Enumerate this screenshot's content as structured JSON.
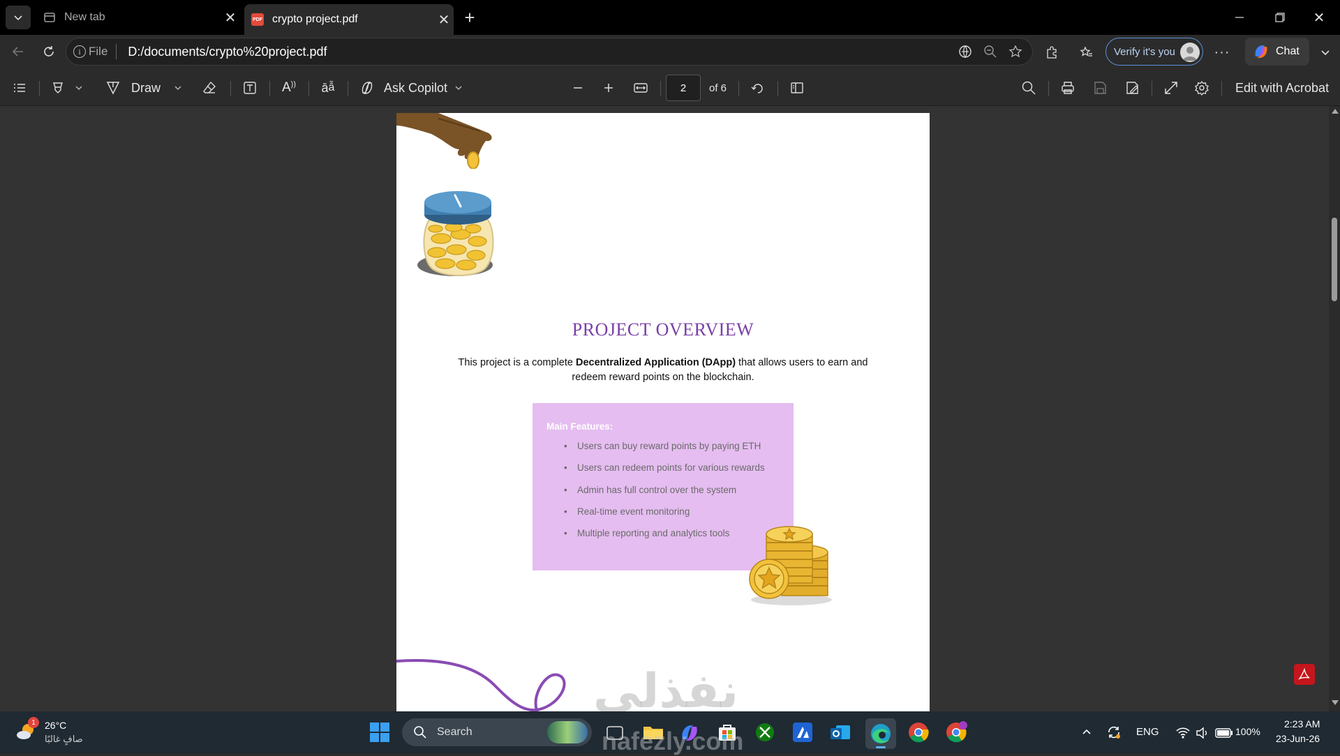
{
  "tabs": [
    {
      "label": "New tab",
      "icon": "new-tab-page-icon",
      "active": false
    },
    {
      "label": "crypto project.pdf",
      "icon": "pdf-file-icon",
      "active": true
    }
  ],
  "address": {
    "scheme_label": "File",
    "url": "D:/documents/crypto%20project.pdf"
  },
  "profile": {
    "verify_label": "Verify it's you"
  },
  "copilot_chat_label": "Chat",
  "pdf_toolbar": {
    "draw_label": "Draw",
    "ask_copilot_label": "Ask Copilot",
    "page_current": "2",
    "page_total_label": "of 6",
    "edit_acrobat_label": "Edit with Acrobat"
  },
  "document": {
    "heading": "PROJECT OVERVIEW",
    "intro_prefix": "This project is a complete ",
    "intro_bold": "Decentralized Application (DApp)",
    "intro_suffix": " that allows users to earn and redeem reward points on the blockchain.",
    "features_heading": "Main Features:",
    "features": [
      "Users can buy reward points by paying ETH",
      "Users can redeem points for various rewards",
      "Admin has full control over the system",
      "Real-time event monitoring",
      "Multiple reporting and analytics tools"
    ]
  },
  "watermark": {
    "arabic": "نفذلي",
    "latin": "nafezly.com"
  },
  "taskbar": {
    "weather_temp": "26°C",
    "weather_desc": "صافٍ غالبًا",
    "weather_badge": "1",
    "search_placeholder": "Search",
    "language": "ENG",
    "battery": "100%",
    "time": "2:23 AM",
    "date": "23-Jun-26"
  },
  "colors": {
    "tab_strip": "#000000",
    "toolbar": "#2b2b2b",
    "viewer_bg": "#333333",
    "accent_heading": "#7a3fa6",
    "feature_box": "#e5bdf0",
    "taskbar": "#1f2a33"
  }
}
